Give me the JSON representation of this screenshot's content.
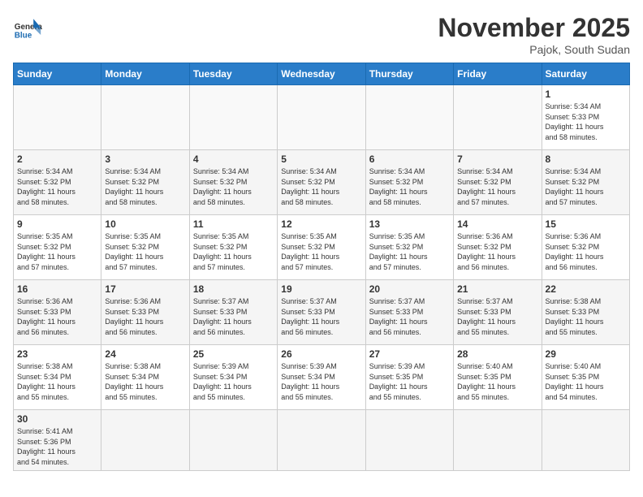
{
  "header": {
    "logo_general": "General",
    "logo_blue": "Blue",
    "month": "November 2025",
    "location": "Pajok, South Sudan"
  },
  "days_of_week": [
    "Sunday",
    "Monday",
    "Tuesday",
    "Wednesday",
    "Thursday",
    "Friday",
    "Saturday"
  ],
  "weeks": [
    [
      {
        "day": "",
        "info": ""
      },
      {
        "day": "",
        "info": ""
      },
      {
        "day": "",
        "info": ""
      },
      {
        "day": "",
        "info": ""
      },
      {
        "day": "",
        "info": ""
      },
      {
        "day": "",
        "info": ""
      },
      {
        "day": "1",
        "info": "Sunrise: 5:34 AM\nSunset: 5:33 PM\nDaylight: 11 hours\nand 58 minutes."
      }
    ],
    [
      {
        "day": "2",
        "info": "Sunrise: 5:34 AM\nSunset: 5:32 PM\nDaylight: 11 hours\nand 58 minutes."
      },
      {
        "day": "3",
        "info": "Sunrise: 5:34 AM\nSunset: 5:32 PM\nDaylight: 11 hours\nand 58 minutes."
      },
      {
        "day": "4",
        "info": "Sunrise: 5:34 AM\nSunset: 5:32 PM\nDaylight: 11 hours\nand 58 minutes."
      },
      {
        "day": "5",
        "info": "Sunrise: 5:34 AM\nSunset: 5:32 PM\nDaylight: 11 hours\nand 58 minutes."
      },
      {
        "day": "6",
        "info": "Sunrise: 5:34 AM\nSunset: 5:32 PM\nDaylight: 11 hours\nand 58 minutes."
      },
      {
        "day": "7",
        "info": "Sunrise: 5:34 AM\nSunset: 5:32 PM\nDaylight: 11 hours\nand 57 minutes."
      },
      {
        "day": "8",
        "info": "Sunrise: 5:34 AM\nSunset: 5:32 PM\nDaylight: 11 hours\nand 57 minutes."
      }
    ],
    [
      {
        "day": "9",
        "info": "Sunrise: 5:35 AM\nSunset: 5:32 PM\nDaylight: 11 hours\nand 57 minutes."
      },
      {
        "day": "10",
        "info": "Sunrise: 5:35 AM\nSunset: 5:32 PM\nDaylight: 11 hours\nand 57 minutes."
      },
      {
        "day": "11",
        "info": "Sunrise: 5:35 AM\nSunset: 5:32 PM\nDaylight: 11 hours\nand 57 minutes."
      },
      {
        "day": "12",
        "info": "Sunrise: 5:35 AM\nSunset: 5:32 PM\nDaylight: 11 hours\nand 57 minutes."
      },
      {
        "day": "13",
        "info": "Sunrise: 5:35 AM\nSunset: 5:32 PM\nDaylight: 11 hours\nand 57 minutes."
      },
      {
        "day": "14",
        "info": "Sunrise: 5:36 AM\nSunset: 5:32 PM\nDaylight: 11 hours\nand 56 minutes."
      },
      {
        "day": "15",
        "info": "Sunrise: 5:36 AM\nSunset: 5:32 PM\nDaylight: 11 hours\nand 56 minutes."
      }
    ],
    [
      {
        "day": "16",
        "info": "Sunrise: 5:36 AM\nSunset: 5:33 PM\nDaylight: 11 hours\nand 56 minutes."
      },
      {
        "day": "17",
        "info": "Sunrise: 5:36 AM\nSunset: 5:33 PM\nDaylight: 11 hours\nand 56 minutes."
      },
      {
        "day": "18",
        "info": "Sunrise: 5:37 AM\nSunset: 5:33 PM\nDaylight: 11 hours\nand 56 minutes."
      },
      {
        "day": "19",
        "info": "Sunrise: 5:37 AM\nSunset: 5:33 PM\nDaylight: 11 hours\nand 56 minutes."
      },
      {
        "day": "20",
        "info": "Sunrise: 5:37 AM\nSunset: 5:33 PM\nDaylight: 11 hours\nand 56 minutes."
      },
      {
        "day": "21",
        "info": "Sunrise: 5:37 AM\nSunset: 5:33 PM\nDaylight: 11 hours\nand 55 minutes."
      },
      {
        "day": "22",
        "info": "Sunrise: 5:38 AM\nSunset: 5:33 PM\nDaylight: 11 hours\nand 55 minutes."
      }
    ],
    [
      {
        "day": "23",
        "info": "Sunrise: 5:38 AM\nSunset: 5:34 PM\nDaylight: 11 hours\nand 55 minutes."
      },
      {
        "day": "24",
        "info": "Sunrise: 5:38 AM\nSunset: 5:34 PM\nDaylight: 11 hours\nand 55 minutes."
      },
      {
        "day": "25",
        "info": "Sunrise: 5:39 AM\nSunset: 5:34 PM\nDaylight: 11 hours\nand 55 minutes."
      },
      {
        "day": "26",
        "info": "Sunrise: 5:39 AM\nSunset: 5:34 PM\nDaylight: 11 hours\nand 55 minutes."
      },
      {
        "day": "27",
        "info": "Sunrise: 5:39 AM\nSunset: 5:35 PM\nDaylight: 11 hours\nand 55 minutes."
      },
      {
        "day": "28",
        "info": "Sunrise: 5:40 AM\nSunset: 5:35 PM\nDaylight: 11 hours\nand 55 minutes."
      },
      {
        "day": "29",
        "info": "Sunrise: 5:40 AM\nSunset: 5:35 PM\nDaylight: 11 hours\nand 54 minutes."
      }
    ],
    [
      {
        "day": "30",
        "info": "Sunrise: 5:41 AM\nSunset: 5:36 PM\nDaylight: 11 hours\nand 54 minutes."
      },
      {
        "day": "",
        "info": ""
      },
      {
        "day": "",
        "info": ""
      },
      {
        "day": "",
        "info": ""
      },
      {
        "day": "",
        "info": ""
      },
      {
        "day": "",
        "info": ""
      },
      {
        "day": "",
        "info": ""
      }
    ]
  ]
}
